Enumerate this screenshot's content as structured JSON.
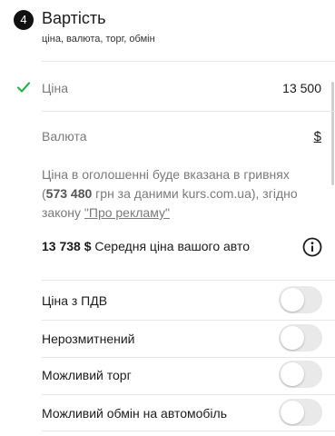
{
  "section": {
    "step_number": "4",
    "title": "Вартість",
    "subtitle": "ціна, валюта, торг, обмін"
  },
  "price": {
    "label": "Ціна",
    "value": "13 500"
  },
  "currency": {
    "label": "Валюта",
    "value": "$"
  },
  "note": {
    "line1": "Ціна в оголошенні буде вказана в гривнях",
    "open_paren": "(",
    "amount": "573 480",
    "line2_rest": " грн за даними kurs.com.ua), згідно",
    "line3_prefix": "закону ",
    "law_link": "\"Про рекламу\""
  },
  "average": {
    "amount": "13 738 $",
    "text": " Середня ціна вашого авто"
  },
  "toggles": [
    {
      "label": "Ціна з ПДВ",
      "on": false
    },
    {
      "label": "Нерозмитнений",
      "on": false
    },
    {
      "label": "Можливий торг",
      "on": false
    },
    {
      "label": "Можливий обмін на автомобіль",
      "on": false
    }
  ],
  "colors": {
    "check": "#2fb24c",
    "toggle_off": "#e9e9e9",
    "badge": "#111111"
  }
}
